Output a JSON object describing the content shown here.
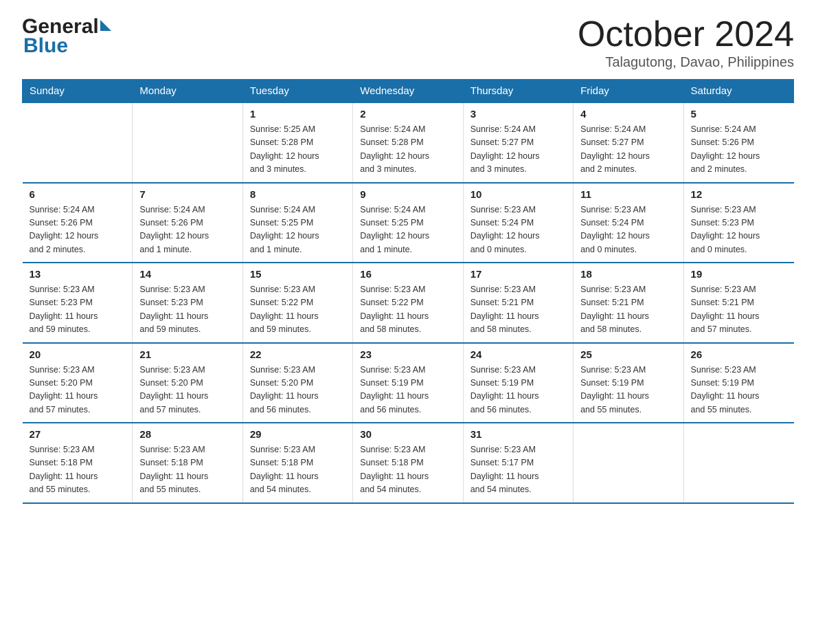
{
  "header": {
    "logo_general": "General",
    "logo_blue": "Blue",
    "month_title": "October 2024",
    "location": "Talagutong, Davao, Philippines"
  },
  "weekdays": [
    "Sunday",
    "Monday",
    "Tuesday",
    "Wednesday",
    "Thursday",
    "Friday",
    "Saturday"
  ],
  "weeks": [
    {
      "days": [
        {
          "number": "",
          "info": ""
        },
        {
          "number": "",
          "info": ""
        },
        {
          "number": "1",
          "info": "Sunrise: 5:25 AM\nSunset: 5:28 PM\nDaylight: 12 hours\nand 3 minutes."
        },
        {
          "number": "2",
          "info": "Sunrise: 5:24 AM\nSunset: 5:28 PM\nDaylight: 12 hours\nand 3 minutes."
        },
        {
          "number": "3",
          "info": "Sunrise: 5:24 AM\nSunset: 5:27 PM\nDaylight: 12 hours\nand 3 minutes."
        },
        {
          "number": "4",
          "info": "Sunrise: 5:24 AM\nSunset: 5:27 PM\nDaylight: 12 hours\nand 2 minutes."
        },
        {
          "number": "5",
          "info": "Sunrise: 5:24 AM\nSunset: 5:26 PM\nDaylight: 12 hours\nand 2 minutes."
        }
      ]
    },
    {
      "days": [
        {
          "number": "6",
          "info": "Sunrise: 5:24 AM\nSunset: 5:26 PM\nDaylight: 12 hours\nand 2 minutes."
        },
        {
          "number": "7",
          "info": "Sunrise: 5:24 AM\nSunset: 5:26 PM\nDaylight: 12 hours\nand 1 minute."
        },
        {
          "number": "8",
          "info": "Sunrise: 5:24 AM\nSunset: 5:25 PM\nDaylight: 12 hours\nand 1 minute."
        },
        {
          "number": "9",
          "info": "Sunrise: 5:24 AM\nSunset: 5:25 PM\nDaylight: 12 hours\nand 1 minute."
        },
        {
          "number": "10",
          "info": "Sunrise: 5:23 AM\nSunset: 5:24 PM\nDaylight: 12 hours\nand 0 minutes."
        },
        {
          "number": "11",
          "info": "Sunrise: 5:23 AM\nSunset: 5:24 PM\nDaylight: 12 hours\nand 0 minutes."
        },
        {
          "number": "12",
          "info": "Sunrise: 5:23 AM\nSunset: 5:23 PM\nDaylight: 12 hours\nand 0 minutes."
        }
      ]
    },
    {
      "days": [
        {
          "number": "13",
          "info": "Sunrise: 5:23 AM\nSunset: 5:23 PM\nDaylight: 11 hours\nand 59 minutes."
        },
        {
          "number": "14",
          "info": "Sunrise: 5:23 AM\nSunset: 5:23 PM\nDaylight: 11 hours\nand 59 minutes."
        },
        {
          "number": "15",
          "info": "Sunrise: 5:23 AM\nSunset: 5:22 PM\nDaylight: 11 hours\nand 59 minutes."
        },
        {
          "number": "16",
          "info": "Sunrise: 5:23 AM\nSunset: 5:22 PM\nDaylight: 11 hours\nand 58 minutes."
        },
        {
          "number": "17",
          "info": "Sunrise: 5:23 AM\nSunset: 5:21 PM\nDaylight: 11 hours\nand 58 minutes."
        },
        {
          "number": "18",
          "info": "Sunrise: 5:23 AM\nSunset: 5:21 PM\nDaylight: 11 hours\nand 58 minutes."
        },
        {
          "number": "19",
          "info": "Sunrise: 5:23 AM\nSunset: 5:21 PM\nDaylight: 11 hours\nand 57 minutes."
        }
      ]
    },
    {
      "days": [
        {
          "number": "20",
          "info": "Sunrise: 5:23 AM\nSunset: 5:20 PM\nDaylight: 11 hours\nand 57 minutes."
        },
        {
          "number": "21",
          "info": "Sunrise: 5:23 AM\nSunset: 5:20 PM\nDaylight: 11 hours\nand 57 minutes."
        },
        {
          "number": "22",
          "info": "Sunrise: 5:23 AM\nSunset: 5:20 PM\nDaylight: 11 hours\nand 56 minutes."
        },
        {
          "number": "23",
          "info": "Sunrise: 5:23 AM\nSunset: 5:19 PM\nDaylight: 11 hours\nand 56 minutes."
        },
        {
          "number": "24",
          "info": "Sunrise: 5:23 AM\nSunset: 5:19 PM\nDaylight: 11 hours\nand 56 minutes."
        },
        {
          "number": "25",
          "info": "Sunrise: 5:23 AM\nSunset: 5:19 PM\nDaylight: 11 hours\nand 55 minutes."
        },
        {
          "number": "26",
          "info": "Sunrise: 5:23 AM\nSunset: 5:19 PM\nDaylight: 11 hours\nand 55 minutes."
        }
      ]
    },
    {
      "days": [
        {
          "number": "27",
          "info": "Sunrise: 5:23 AM\nSunset: 5:18 PM\nDaylight: 11 hours\nand 55 minutes."
        },
        {
          "number": "28",
          "info": "Sunrise: 5:23 AM\nSunset: 5:18 PM\nDaylight: 11 hours\nand 55 minutes."
        },
        {
          "number": "29",
          "info": "Sunrise: 5:23 AM\nSunset: 5:18 PM\nDaylight: 11 hours\nand 54 minutes."
        },
        {
          "number": "30",
          "info": "Sunrise: 5:23 AM\nSunset: 5:18 PM\nDaylight: 11 hours\nand 54 minutes."
        },
        {
          "number": "31",
          "info": "Sunrise: 5:23 AM\nSunset: 5:17 PM\nDaylight: 11 hours\nand 54 minutes."
        },
        {
          "number": "",
          "info": ""
        },
        {
          "number": "",
          "info": ""
        }
      ]
    }
  ]
}
